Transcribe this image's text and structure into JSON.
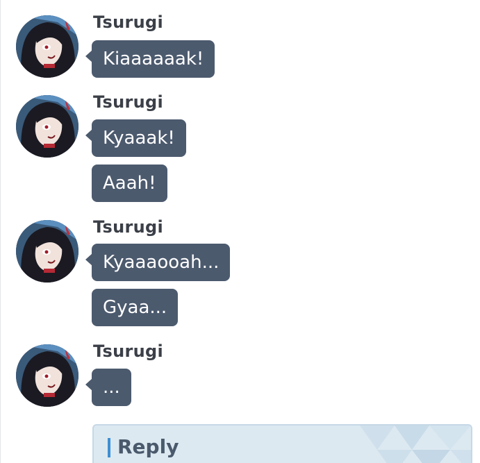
{
  "colors": {
    "bubble_bg": "#4c5a6e",
    "bubble_text": "#ffffff",
    "sender_text": "#3b3f47",
    "reply_bg": "#dde9f1",
    "reply_border": "#c5d8e6",
    "reply_accent": "#3d8fd4"
  },
  "messages": [
    {
      "sender": "Tsurugi",
      "avatar_icon": "character-avatar",
      "bubbles": [
        "Kiaaaaaak!"
      ]
    },
    {
      "sender": "Tsurugi",
      "avatar_icon": "character-avatar",
      "bubbles": [
        "Kyaaak!",
        "Aaah!"
      ]
    },
    {
      "sender": "Tsurugi",
      "avatar_icon": "character-avatar",
      "bubbles": [
        "Kyaaaooah...",
        "Gyaa..."
      ]
    },
    {
      "sender": "Tsurugi",
      "avatar_icon": "character-avatar",
      "bubbles": [
        "..."
      ]
    }
  ],
  "reply": {
    "label": "Reply",
    "accent_icon": "reply-accent-bar"
  }
}
